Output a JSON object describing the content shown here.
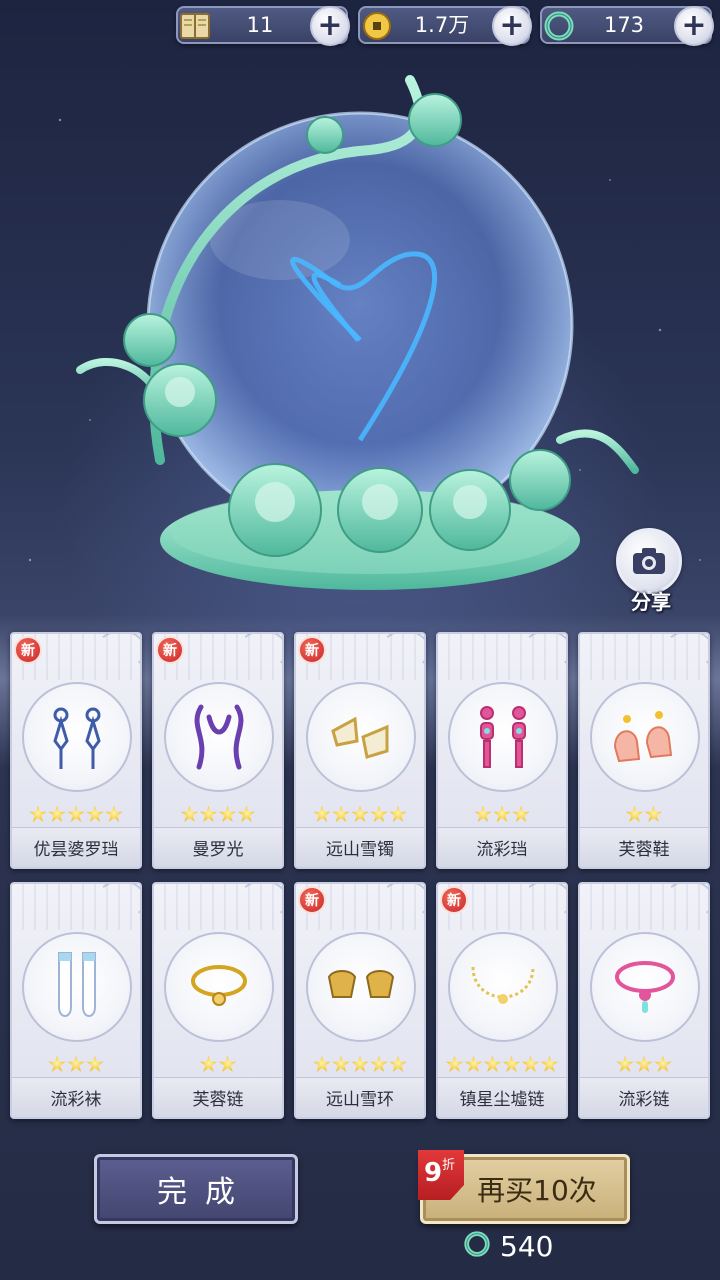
{
  "currencies": [
    {
      "icon": "book-icon",
      "value": "11"
    },
    {
      "icon": "coin-icon",
      "value": "1.7万"
    },
    {
      "icon": "jade-icon",
      "value": "173"
    }
  ],
  "share": {
    "label": "分享"
  },
  "items": [
    {
      "name": "优昙婆罗珰",
      "stars": 5,
      "new": true
    },
    {
      "name": "曼罗光",
      "stars": 4,
      "new": true
    },
    {
      "name": "远山雪镯",
      "stars": 5,
      "new": true
    },
    {
      "name": "流彩珰",
      "stars": 3,
      "new": false
    },
    {
      "name": "芙蓉鞋",
      "stars": 2,
      "new": false
    },
    {
      "name": "流彩袜",
      "stars": 3,
      "new": false
    },
    {
      "name": "芙蓉链",
      "stars": 2,
      "new": false
    },
    {
      "name": "远山雪环",
      "stars": 5,
      "new": true
    },
    {
      "name": "镇星尘墟链",
      "stars": 6,
      "new": true
    },
    {
      "name": "流彩链",
      "stars": 3,
      "new": false
    }
  ],
  "new_badge": "新",
  "buttons": {
    "done": "完成",
    "again": "再买10次",
    "discount_number": "9",
    "discount_unit": "折",
    "cost": "540"
  }
}
